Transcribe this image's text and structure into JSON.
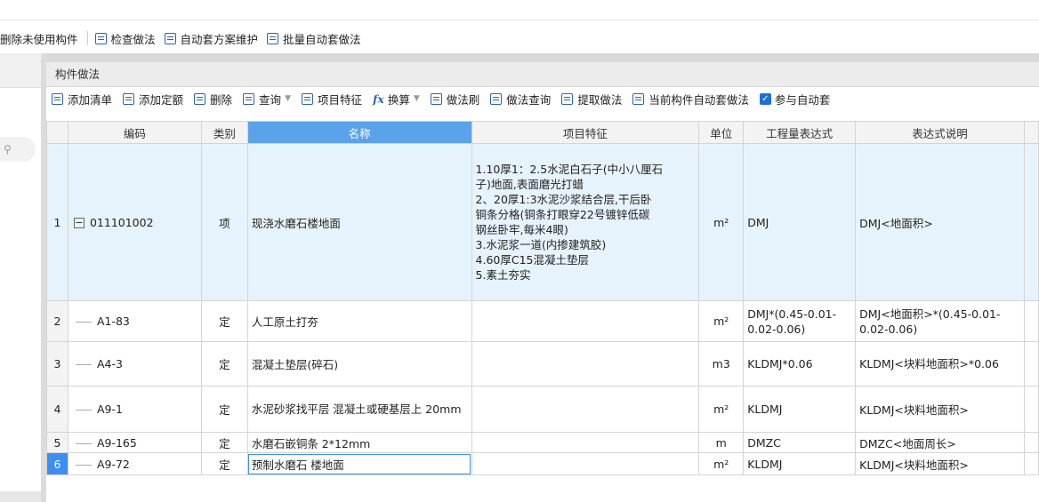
{
  "toolbar_top": [
    {
      "label": "删除未使用构件",
      "icon": "none"
    },
    {
      "label": "检查做法",
      "icon": "check-method-icon"
    },
    {
      "label": "自动套方案维护",
      "icon": "auto-scheme-icon"
    },
    {
      "label": "批量自动套做法",
      "icon": "batch-auto-icon"
    }
  ],
  "panel_title": "构件做法",
  "toolbar_grid": {
    "add_list": "添加清单",
    "add_quota": "添加定额",
    "delete": "删除",
    "query": "查询",
    "item_feature": "项目特征",
    "convert": "换算",
    "method_brush": "做法刷",
    "method_query": "做法查询",
    "extract": "提取做法",
    "current_auto": "当前构件自动套做法",
    "participate": "参与自动套"
  },
  "columns": [
    "编码",
    "类别",
    "名称",
    "项目特征",
    "单位",
    "工程量表达式",
    "表达式说明"
  ],
  "rows": [
    {
      "index": "1",
      "code": "011101002",
      "type": "项",
      "name": "现浇水磨石楼地面",
      "feature": [
        "1.10厚1：2.5水泥白石子(中小八厘石",
        "子)地面,表面磨光打蜡",
        "2、20厚1:3水泥沙浆结合层,干后卧",
        "铜条分格(铜条打眼穿22号镀锌低碳",
        "钢丝卧牢,每米4眼)",
        "3.水泥浆一道(内掺建筑胶)",
        "4.60厚C15混凝土垫层",
        "5.素土夯实"
      ],
      "unit": "m²",
      "expr": "DMJ",
      "desc": "DMJ<地面积>"
    },
    {
      "index": "2",
      "code": "A1-83",
      "type": "定",
      "name": "人工原土打夯",
      "feature": [],
      "unit": "m²",
      "expr": "DMJ*(0.45-0.01-0.02-0.06)",
      "desc": "DMJ<地面积>*(0.45-0.01-0.02-0.06)"
    },
    {
      "index": "3",
      "code": "A4-3",
      "type": "定",
      "name": "混凝土垫层(碎石)",
      "feature": [],
      "unit": "m3",
      "expr": "KLDMJ*0.06",
      "desc": "KLDMJ<块料地面积>*0.06"
    },
    {
      "index": "4",
      "code": "A9-1",
      "type": "定",
      "name": "水泥砂浆找平层 混凝土或硬基层上 20mm",
      "feature": [],
      "unit": "m²",
      "expr": "KLDMJ",
      "desc": "KLDMJ<块料地面积>"
    },
    {
      "index": "5",
      "code": "A9-165",
      "type": "定",
      "name": "水磨石嵌铜条 2*12mm",
      "feature": [],
      "unit": "m",
      "expr": "DMZC",
      "desc": "DMZC<地面周长>"
    },
    {
      "index": "6",
      "code": "A9-72",
      "type": "定",
      "name": "预制水磨石 楼地面",
      "feature": [],
      "unit": "m²",
      "expr": "KLDMJ",
      "desc": "KLDMJ<块料地面积>"
    }
  ]
}
